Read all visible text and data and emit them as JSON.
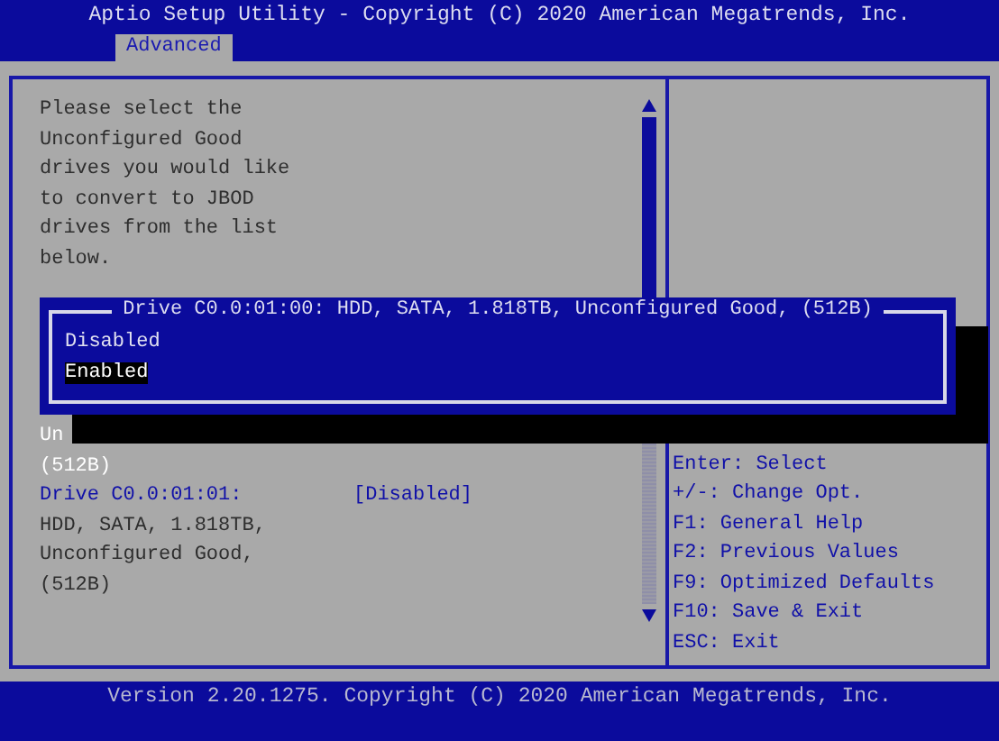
{
  "title_bar": {
    "title": "Aptio Setup Utility - Copyright (C) 2020 American Megatrends, Inc."
  },
  "tabs": [
    {
      "label": "Advanced",
      "selected": true
    }
  ],
  "description": [
    "Please select the",
    "Unconfigured Good",
    "drives you would like",
    "to convert to JBOD",
    "drives from the list",
    "below."
  ],
  "items": [
    {
      "lines": [
        "Un",
        "(512B)"
      ],
      "selected": true
    },
    {
      "lines": [
        "Drive C0.0:01:01:",
        "HDD, SATA, 1.818TB,",
        "Unconfigured Good,",
        "(512B)"
      ],
      "value": "[Disabled]",
      "selected": false
    }
  ],
  "help": [
    "Enter: Select",
    "+/-: Change Opt.",
    "F1: General Help",
    "F2: Previous Values",
    "F9: Optimized Defaults",
    "F10: Save & Exit",
    "ESC: Exit"
  ],
  "popup": {
    "title": "Drive C0.0:01:00: HDD, SATA, 1.818TB, Unconfigured Good, (512B)",
    "options": [
      {
        "label": "Disabled",
        "selected": false
      },
      {
        "label": "Enabled",
        "selected": true
      }
    ]
  },
  "footer": {
    "version": "Version 2.20.1275. Copyright (C) 2020 American Megatrends, Inc."
  }
}
